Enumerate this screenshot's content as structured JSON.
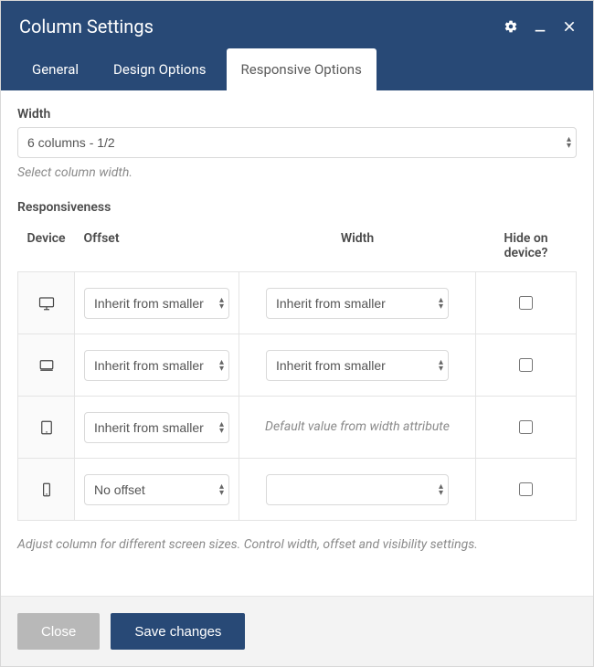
{
  "header": {
    "title": "Column Settings"
  },
  "tabs": [
    {
      "label": "General",
      "active": false
    },
    {
      "label": "Design Options",
      "active": false
    },
    {
      "label": "Responsive Options",
      "active": true
    }
  ],
  "width_section": {
    "label": "Width",
    "value": "6 columns - 1/2",
    "hint": "Select column width."
  },
  "responsiveness": {
    "label": "Responsiveness",
    "columns": {
      "device": "Device",
      "offset": "Offset",
      "width": "Width",
      "hide": "Hide on device?"
    },
    "rows": [
      {
        "device": "desktop-large",
        "offset": "Inherit from smaller",
        "width_type": "select",
        "width": "Inherit from smaller",
        "hide": false
      },
      {
        "device": "desktop",
        "offset": "Inherit from smaller",
        "width_type": "select",
        "width": "Inherit from smaller",
        "hide": false
      },
      {
        "device": "tablet",
        "offset": "Inherit from smaller",
        "width_type": "text",
        "width": "Default value from width attribute",
        "hide": false
      },
      {
        "device": "phone",
        "offset": "No offset",
        "width_type": "select",
        "width": "",
        "hide": false
      }
    ],
    "footnote": "Adjust column for different screen sizes. Control width, offset and visibility settings."
  },
  "footer": {
    "close": "Close",
    "save": "Save changes"
  }
}
